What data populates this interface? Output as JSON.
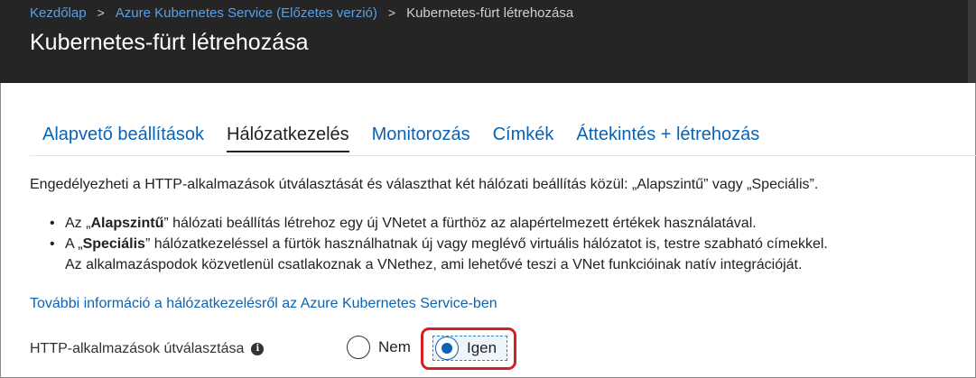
{
  "breadcrumb": {
    "items": [
      "Kezdőlap",
      "Azure Kubernetes Service (Előzetes verzió)"
    ],
    "current": "Kubernetes-fürt létrehozása",
    "separator": ">"
  },
  "header": {
    "title": "Kubernetes-fürt létrehozása"
  },
  "tabs": [
    {
      "label": "Alapvető beállítások",
      "active": false
    },
    {
      "label": "Hálózatkezelés",
      "active": true
    },
    {
      "label": "Monitorozás",
      "active": false
    },
    {
      "label": "Címkék",
      "active": false
    },
    {
      "label": "Áttekintés + létrehozás",
      "active": false
    }
  ],
  "content": {
    "intro": "Engedélyezheti a HTTP-alkalmazások útválasztását és választhat két hálózati beállítás közül: „Alapszintű” vagy „Speciális”.",
    "bullet1": {
      "prefix": "Az „",
      "bold": "Alapszintű",
      "suffix": "” hálózati beállítás létrehoz egy új VNetet a fürthöz az alapértelmezett értékek használatával."
    },
    "bullet2": {
      "prefix": "A „",
      "bold": "Speciális",
      "suffix": "” hálózatkezeléssel a fürtök használhatnak új vagy meglévő virtuális hálózatot is, testre szabható címekkel.",
      "line2": "Az alkalmazáspodok közvetlenül csatlakoznak a VNethez, ami lehetővé teszi a VNet funkcióinak natív integrációját."
    },
    "bullet_char": "•",
    "learn_more": "További információ a hálózatkezelésről az Azure Kubernetes Service-ben"
  },
  "http_routing": {
    "label": "HTTP-alkalmazások útválasztása",
    "info_icon": "i",
    "options": [
      {
        "label": "Nem",
        "selected": false
      },
      {
        "label": "Igen",
        "selected": true
      }
    ]
  },
  "colors": {
    "header_bg": "#252525",
    "link": "#0a63b5",
    "breadcrumb_link": "#5aa0e6",
    "highlight": "#d41f26"
  }
}
